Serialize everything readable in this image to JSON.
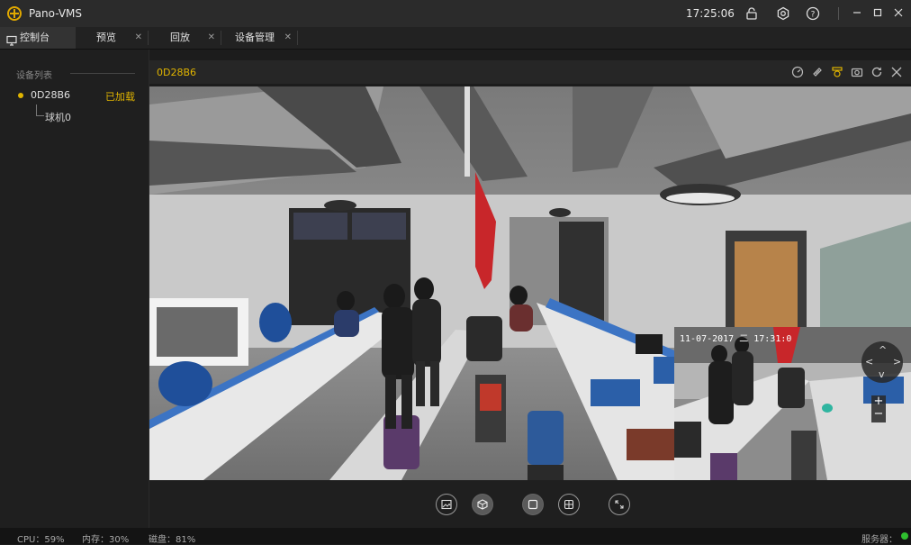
{
  "window": {
    "title": "Pano-VMS",
    "time": "17:25:06",
    "icons": [
      "lock-icon",
      "gear-icon",
      "help-icon",
      "minimize-icon",
      "maximize-icon",
      "close-icon"
    ]
  },
  "tabs": [
    {
      "label": "控制台",
      "icon": "monitor-icon",
      "closable": false,
      "active": true
    },
    {
      "label": "预览",
      "closable": true
    },
    {
      "label": "回放",
      "closable": true
    },
    {
      "label": "设备管理",
      "closable": true
    }
  ],
  "sidebar": {
    "header": "设备列表",
    "device": {
      "name": "0D28B6",
      "status": "已加载"
    },
    "children": [
      "球机0"
    ]
  },
  "view": {
    "title": "0D28B6",
    "toolbar_icons": [
      "gauge-icon",
      "link-icon",
      "record-icon",
      "camera-icon",
      "refresh-icon",
      "close-icon"
    ],
    "pip_timestamp": "11-07-2017  二 17:31:0"
  },
  "controls": [
    "image-icon",
    "cube-icon",
    "single-view-icon",
    "quad-view-icon",
    "fullscreen-icon"
  ],
  "status": {
    "cpu": "CPU：59%",
    "memory": "内存：30%",
    "disk": "磁盘：81%",
    "server": "服务器："
  },
  "colors": {
    "accent": "#e0b400",
    "server_ok": "#2fbf2f"
  }
}
